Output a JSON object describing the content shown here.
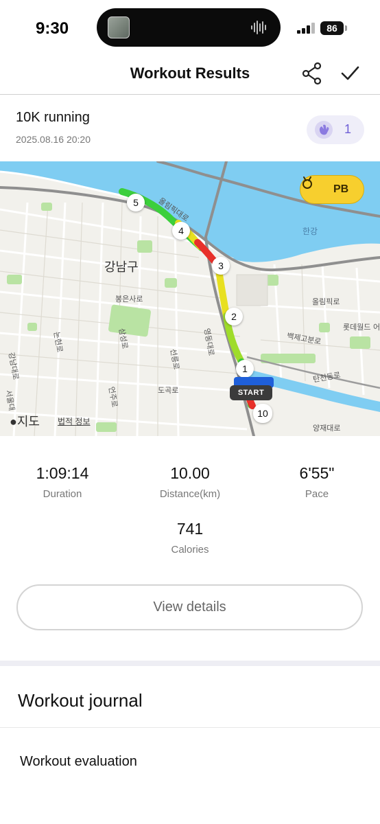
{
  "status_bar": {
    "time": "9:30",
    "battery": "86"
  },
  "header": {
    "title": "Workout Results",
    "share_icon": "share-icon",
    "done_icon": "checkmark-icon"
  },
  "workout": {
    "name": "10K running",
    "date": "2025.08.16 20:20",
    "claps": "1"
  },
  "map": {
    "badge": "PB",
    "district": "강남구",
    "river": "한강",
    "route_marker_labels": [
      "1",
      "2",
      "3",
      "4",
      "5",
      "10"
    ],
    "start_label": "START",
    "attribution": "지도",
    "legal": "법적 정보",
    "roads": {
      "olympic": "올림픽대로",
      "olympic_ro": "올림픽로",
      "bongeunsa": "봉은사로",
      "baekje": "백제고분로",
      "tancheon": "탄천동로",
      "yangjae": "양재대로",
      "dogok": "도곡로",
      "eonju": "언주로",
      "seolleung": "선릉로",
      "yeongdong": "영동대로",
      "nonhyeon": "논현로",
      "gangnam": "강남대로",
      "samseong": "삼성로",
      "seoul_r": "서울대",
      "lotte": "롯데월드 어"
    },
    "route_colors": {
      "fast": "#33cc33",
      "medium": "#e8e020",
      "slow": "#e8302a"
    },
    "water_color": "#7fcdf2"
  },
  "stats": [
    {
      "value": "1:09:14",
      "label": "Duration"
    },
    {
      "value": "10.00",
      "label": "Distance(km)"
    },
    {
      "value": "6'55\"",
      "label": "Pace"
    },
    {
      "value": "741",
      "label": "Calories"
    }
  ],
  "view_details": "View details",
  "journal": {
    "title": "Workout journal",
    "evaluation": "Workout evaluation"
  }
}
